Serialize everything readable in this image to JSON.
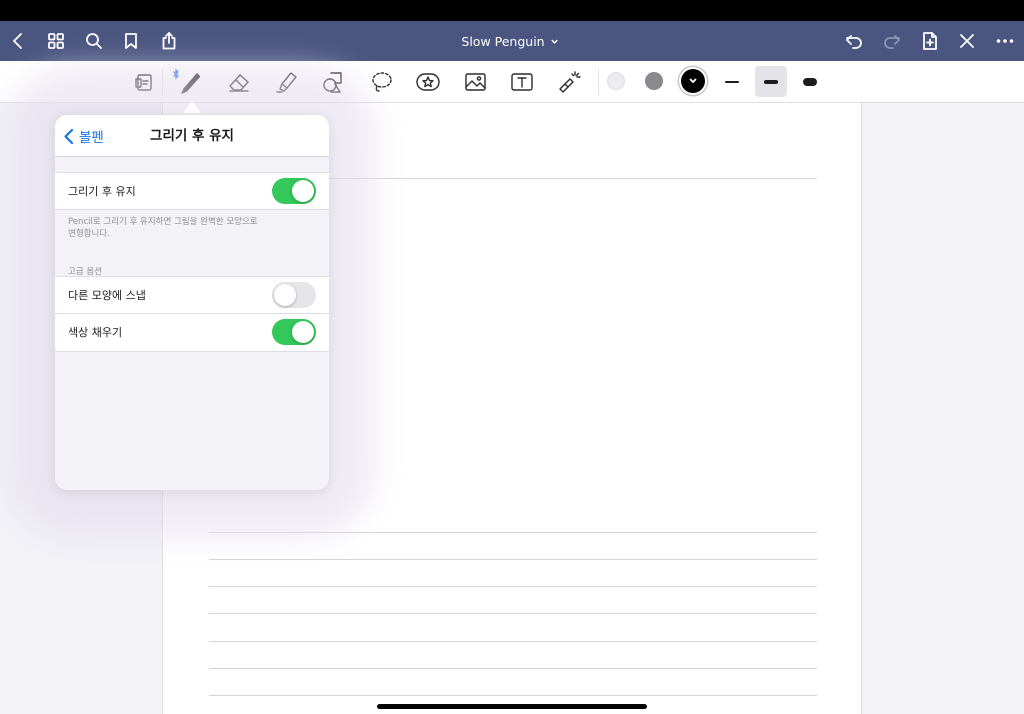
{
  "nav": {
    "title": "Slow Penguin",
    "icons": [
      "back-icon",
      "grid-icon",
      "search-icon",
      "bookmark-icon",
      "share-icon",
      "undo-icon",
      "redo-icon",
      "add-page-icon",
      "close-icon",
      "more-icon"
    ],
    "redo_enabled": false
  },
  "toolbar": {
    "tools": [
      "read-only-icon",
      "pen-icon",
      "eraser-icon",
      "highlighter-icon",
      "shapes-icon",
      "lasso-icon",
      "elements-icon",
      "image-icon",
      "text-icon",
      "laser-pointer-icon"
    ],
    "selected_tool": "pen-icon",
    "colors": [
      "#ececef",
      "#8a8a8e",
      "#000000"
    ],
    "selected_color": "#000000",
    "widths": [
      "thin",
      "medium",
      "thick"
    ],
    "selected_width": "medium"
  },
  "popover": {
    "back_label": "볼펜",
    "title": "그리기 후 유지",
    "rows": [
      {
        "label": "그리기 후 유지",
        "on": true
      }
    ],
    "footnote": "Pencil로 그리기 후 유지하면 그림을 완벽한 모양으로 변형합니다.",
    "section_title": "고급 옵션",
    "advanced": [
      {
        "label": "다른 모양에 스냅",
        "on": false
      },
      {
        "label": "색상 채우기",
        "on": true
      }
    ]
  },
  "colors": {
    "nav_bg": "#4a5680",
    "toggle_on": "#34c759",
    "accent": "#1a73e8"
  }
}
